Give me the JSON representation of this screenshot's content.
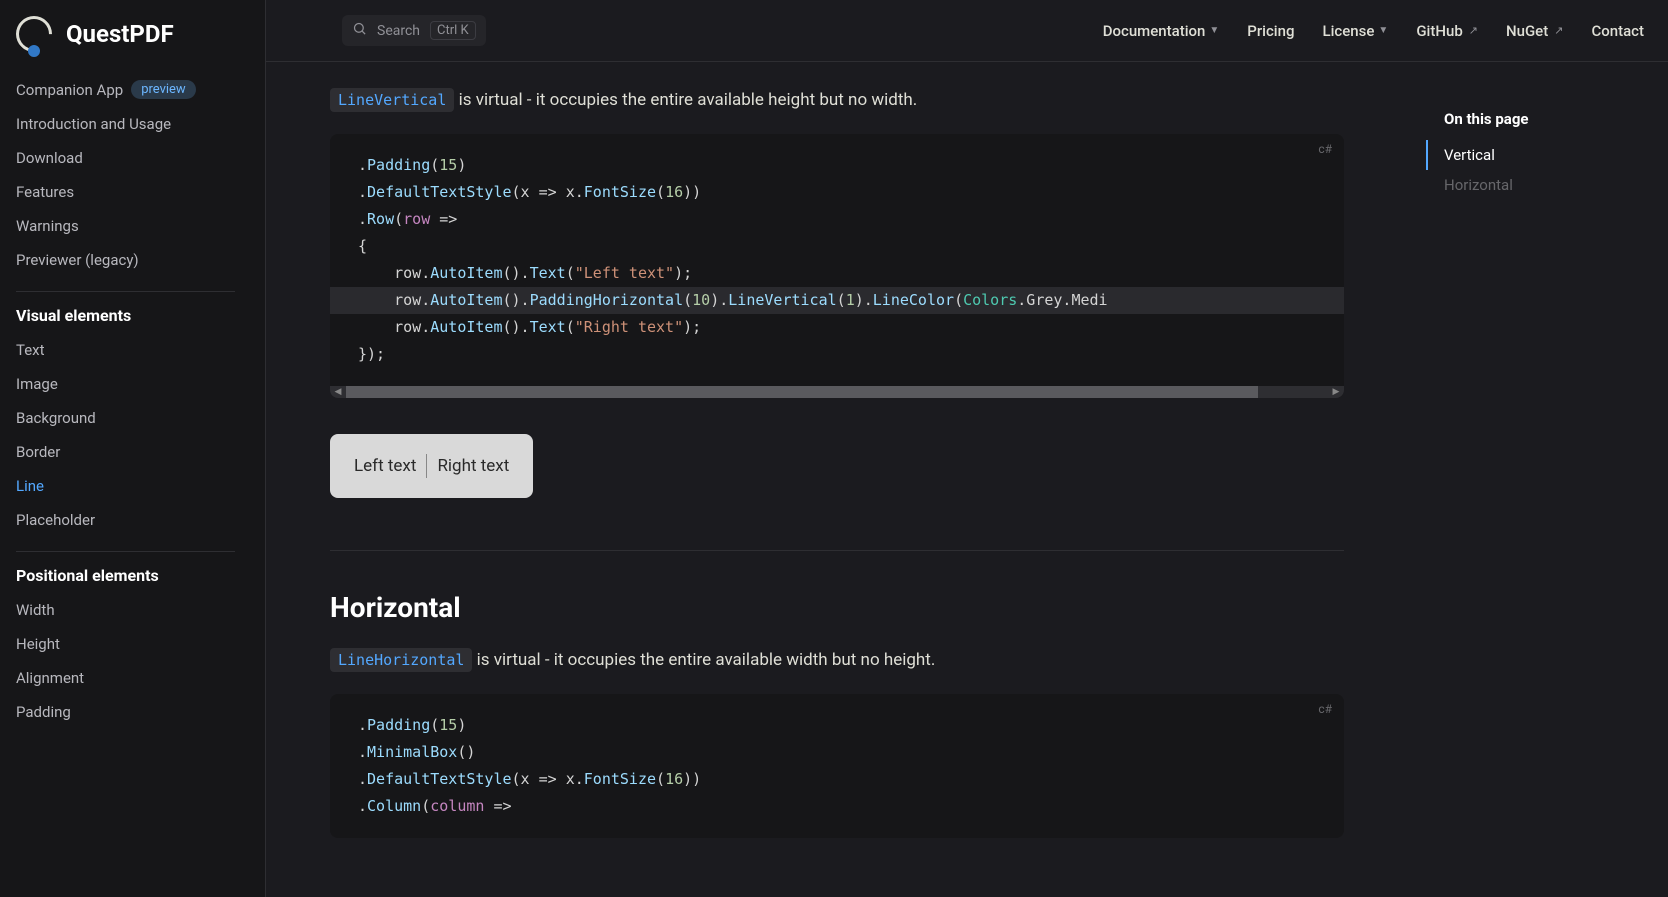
{
  "brand": "QuestPDF",
  "header": {
    "search": "Search",
    "kbd": "Ctrl K",
    "links": [
      {
        "label": "Documentation",
        "kind": "dropdown"
      },
      {
        "label": "Pricing",
        "kind": "plain"
      },
      {
        "label": "License",
        "kind": "dropdown"
      },
      {
        "label": "GitHub",
        "kind": "external"
      },
      {
        "label": "NuGet",
        "kind": "external"
      },
      {
        "label": "Contact",
        "kind": "plain"
      }
    ]
  },
  "sidebar": {
    "first": {
      "label": "Companion App",
      "badge": "preview"
    },
    "top": [
      "Introduction and Usage",
      "Download",
      "Features",
      "Warnings",
      "Previewer (legacy)"
    ],
    "visual_title": "Visual elements",
    "visual": [
      "Text",
      "Image",
      "Background",
      "Border",
      "Line",
      "Placeholder"
    ],
    "visual_active": "Line",
    "pos_title": "Positional elements",
    "positional": [
      "Width",
      "Height",
      "Alignment",
      "Padding"
    ]
  },
  "content": {
    "vertical": {
      "code_tag": "LineVertical",
      "desc_rest": " is virtual - it occupies the entire available height but no width.",
      "lang": "c#",
      "code_lines": [
        {
          "hl": false,
          "segs": [
            {
              "t": ".",
              "c": "plain"
            },
            {
              "t": "Padding",
              "c": "method"
            },
            {
              "t": "(",
              "c": "plain"
            },
            {
              "t": "15",
              "c": "num"
            },
            {
              "t": ")",
              "c": "plain"
            }
          ]
        },
        {
          "hl": false,
          "segs": [
            {
              "t": ".",
              "c": "plain"
            },
            {
              "t": "DefaultTextStyle",
              "c": "method"
            },
            {
              "t": "(x => x.",
              "c": "plain"
            },
            {
              "t": "FontSize",
              "c": "method"
            },
            {
              "t": "(",
              "c": "plain"
            },
            {
              "t": "16",
              "c": "num"
            },
            {
              "t": "))",
              "c": "plain"
            }
          ]
        },
        {
          "hl": false,
          "segs": [
            {
              "t": ".",
              "c": "plain"
            },
            {
              "t": "Row",
              "c": "method"
            },
            {
              "t": "(",
              "c": "plain"
            },
            {
              "t": "row",
              "c": "var"
            },
            {
              "t": " =>",
              "c": "plain"
            }
          ]
        },
        {
          "hl": false,
          "segs": [
            {
              "t": "{",
              "c": "plain"
            }
          ]
        },
        {
          "hl": false,
          "segs": [
            {
              "t": "    row.",
              "c": "plain"
            },
            {
              "t": "AutoItem",
              "c": "method"
            },
            {
              "t": "().",
              "c": "plain"
            },
            {
              "t": "Text",
              "c": "method"
            },
            {
              "t": "(",
              "c": "plain"
            },
            {
              "t": "\"Left text\"",
              "c": "str"
            },
            {
              "t": ");",
              "c": "plain"
            }
          ]
        },
        {
          "hl": true,
          "segs": [
            {
              "t": "    row.",
              "c": "plain"
            },
            {
              "t": "AutoItem",
              "c": "method"
            },
            {
              "t": "().",
              "c": "plain"
            },
            {
              "t": "PaddingHorizontal",
              "c": "method"
            },
            {
              "t": "(",
              "c": "plain"
            },
            {
              "t": "10",
              "c": "num"
            },
            {
              "t": ").",
              "c": "plain"
            },
            {
              "t": "LineVertical",
              "c": "method"
            },
            {
              "t": "(",
              "c": "plain"
            },
            {
              "t": "1",
              "c": "num"
            },
            {
              "t": ").",
              "c": "plain"
            },
            {
              "t": "LineColor",
              "c": "method"
            },
            {
              "t": "(",
              "c": "plain"
            },
            {
              "t": "Colors",
              "c": "type"
            },
            {
              "t": ".Grey.Medi",
              "c": "plain"
            }
          ]
        },
        {
          "hl": false,
          "segs": [
            {
              "t": "    row.",
              "c": "plain"
            },
            {
              "t": "AutoItem",
              "c": "method"
            },
            {
              "t": "().",
              "c": "plain"
            },
            {
              "t": "Text",
              "c": "method"
            },
            {
              "t": "(",
              "c": "plain"
            },
            {
              "t": "\"Right text\"",
              "c": "str"
            },
            {
              "t": ");",
              "c": "plain"
            }
          ]
        },
        {
          "hl": false,
          "segs": [
            {
              "t": "});",
              "c": "plain"
            }
          ]
        }
      ],
      "example": {
        "left": "Left text",
        "right": "Right text"
      }
    },
    "horizontal": {
      "title": "Horizontal",
      "code_tag": "LineHorizontal",
      "desc_rest": " is virtual - it occupies the entire available width but no height.",
      "lang": "c#",
      "code_lines": [
        {
          "hl": false,
          "segs": [
            {
              "t": ".",
              "c": "plain"
            },
            {
              "t": "Padding",
              "c": "method"
            },
            {
              "t": "(",
              "c": "plain"
            },
            {
              "t": "15",
              "c": "num"
            },
            {
              "t": ")",
              "c": "plain"
            }
          ]
        },
        {
          "hl": false,
          "segs": [
            {
              "t": ".",
              "c": "plain"
            },
            {
              "t": "MinimalBox",
              "c": "method"
            },
            {
              "t": "()",
              "c": "plain"
            }
          ]
        },
        {
          "hl": false,
          "segs": [
            {
              "t": ".",
              "c": "plain"
            },
            {
              "t": "DefaultTextStyle",
              "c": "method"
            },
            {
              "t": "(x => x.",
              "c": "plain"
            },
            {
              "t": "FontSize",
              "c": "method"
            },
            {
              "t": "(",
              "c": "plain"
            },
            {
              "t": "16",
              "c": "num"
            },
            {
              "t": "))",
              "c": "plain"
            }
          ]
        },
        {
          "hl": false,
          "segs": [
            {
              "t": ".",
              "c": "plain"
            },
            {
              "t": "Column",
              "c": "method"
            },
            {
              "t": "(",
              "c": "plain"
            },
            {
              "t": "column",
              "c": "var"
            },
            {
              "t": " =>",
              "c": "plain"
            }
          ]
        }
      ]
    }
  },
  "toc": {
    "title": "On this page",
    "items": [
      {
        "label": "Vertical",
        "active": true
      },
      {
        "label": "Horizontal",
        "active": false
      }
    ]
  }
}
